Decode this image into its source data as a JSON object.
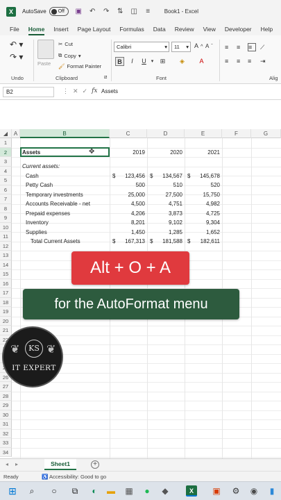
{
  "titlebar": {
    "app_letter": "X",
    "autosave_label": "AutoSave",
    "autosave_state": "Off",
    "title": "Book1 - Excel"
  },
  "ribbon_tabs": [
    "File",
    "Home",
    "Insert",
    "Page Layout",
    "Formulas",
    "Data",
    "Review",
    "View",
    "Developer",
    "Help"
  ],
  "ribbon": {
    "undo_label": "Undo",
    "paste_label": "Paste",
    "cut_label": "Cut",
    "copy_label": "Copy",
    "format_painter_label": "Format Painter",
    "clipboard_label": "Clipboard",
    "font_name": "Calibri",
    "font_size": "11",
    "font_label": "Font",
    "alignment_label": "Alig",
    "bold": "B",
    "italic": "I",
    "underline": "U"
  },
  "formula_bar": {
    "name_box": "B2",
    "fx": "fx",
    "value": "Assets"
  },
  "grid": {
    "columns": [
      "A",
      "B",
      "C",
      "D",
      "E",
      "F",
      "G"
    ],
    "rows": [
      "1",
      "2",
      "3",
      "4",
      "5",
      "6",
      "7",
      "8",
      "9",
      "10",
      "11",
      "12",
      "13",
      "14",
      "15",
      "16",
      "17",
      "18",
      "19",
      "20",
      "21",
      "22",
      "23",
      "24",
      "25",
      "26",
      "27",
      "28",
      "29",
      "30",
      "31",
      "32",
      "33",
      "34"
    ],
    "selected_column": "B",
    "selected_row": "2",
    "cells": {
      "b2": "Assets",
      "c2": "2019",
      "d2": "2020",
      "e2": "2021",
      "b3": "Current assets:",
      "dollar": "$",
      "b4": "Cash",
      "c4": "123,456",
      "d4": "134,567",
      "e4": "145,678",
      "b5": "Petty Cash",
      "c5": "500",
      "d5": "510",
      "e5": "520",
      "b6": "Temporary investments",
      "c6": "25,000",
      "d6": "27,500",
      "e6": "15,750",
      "b7": "Accounts Receivable - net",
      "c7": "4,500",
      "d7": "4,751",
      "e7": "4,982",
      "b8": "Prepaid expenses",
      "c8": "4,206",
      "d8": "3,873",
      "e8": "4,725",
      "b9": "Inventory",
      "c9": "8,201",
      "d9": "9,102",
      "e9": "9,304",
      "b10": "Supplies",
      "c10": "1,450",
      "d10": "1,285",
      "e10": "1,652",
      "b11": "Total Current Assets",
      "c11": "167,313",
      "d11": "181,588",
      "e11": "182,611"
    }
  },
  "overlay": {
    "shortcut": "Alt + O + A",
    "caption": "for the AutoFormat menu"
  },
  "logo": {
    "monogram": "KS",
    "text": "IT EXPERT"
  },
  "sheets": {
    "active": "Sheet1",
    "add": "+"
  },
  "statusbar": {
    "ready": "Ready",
    "accessibility": "Accessibility: Good to go"
  }
}
